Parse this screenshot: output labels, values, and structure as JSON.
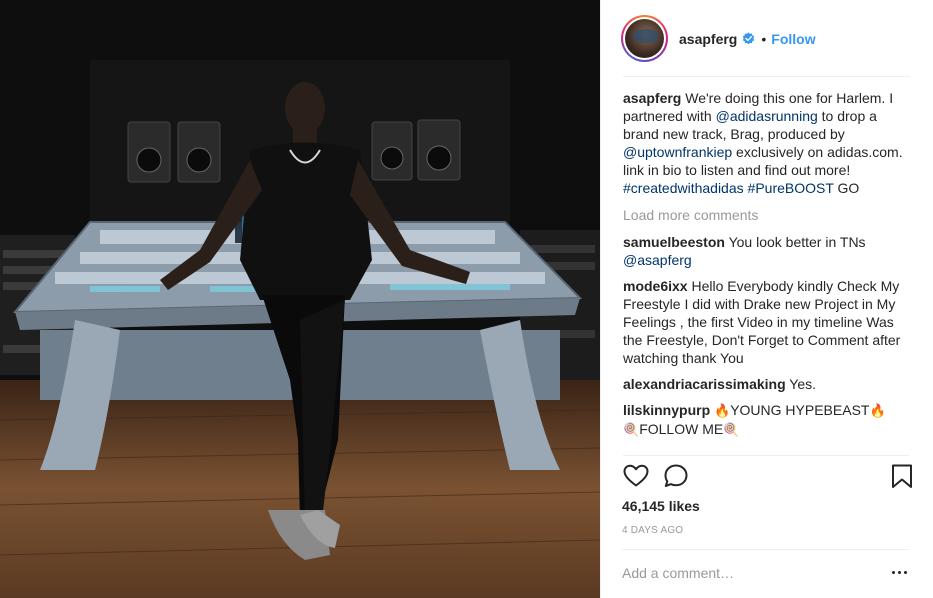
{
  "post": {
    "username": "asapferg",
    "follow_label": "Follow",
    "separator": "•",
    "photo_alt": "Man standing in front of a mixing console in a recording studio"
  },
  "caption": {
    "username": "asapferg",
    "parts": [
      "We're doing this one for Harlem. I partnered with ",
      "@adidasrunning",
      " to drop a brand new track, Brag, produced by ",
      "@uptownfrankiep",
      " exclusively on adidas.com. link in bio to listen and find out more!  ",
      "#createdwithadidas",
      " ",
      "#PureBOOST",
      " GO"
    ]
  },
  "load_more_label": "Load more comments",
  "comments": [
    {
      "username": "samuelbeeston",
      "text": "You look better in TNs ",
      "mention": "@asapferg"
    },
    {
      "username": "mode6ixx",
      "text": "Hello Everybody kindly Check My Freestyle I did with Drake new Project in My Feelings , the first Video in my timeline Was the Freestyle, Don't Forget to Comment after watching thank You"
    },
    {
      "username": "alexandriacarissimaking",
      "text": "Yes."
    },
    {
      "username": "lilskinnypurp",
      "emoji_fire": "🔥",
      "text_a": "YOUNG HYPEBEAST",
      "emoji_lollipop": "🍭",
      "text_b": "FOLLOW ME"
    }
  ],
  "icons": {
    "like": "heart-icon",
    "comment": "comment-icon",
    "save": "bookmark-icon",
    "verified": "verified-badge-icon",
    "more": "more-options-icon"
  },
  "likes": "46,145 likes",
  "timestamp": "4 DAYS AGO",
  "add_comment_placeholder": "Add a comment…",
  "colors": {
    "link": "#003569",
    "follow": "#3897f0",
    "muted": "#999999",
    "verified": "#3897f0"
  }
}
